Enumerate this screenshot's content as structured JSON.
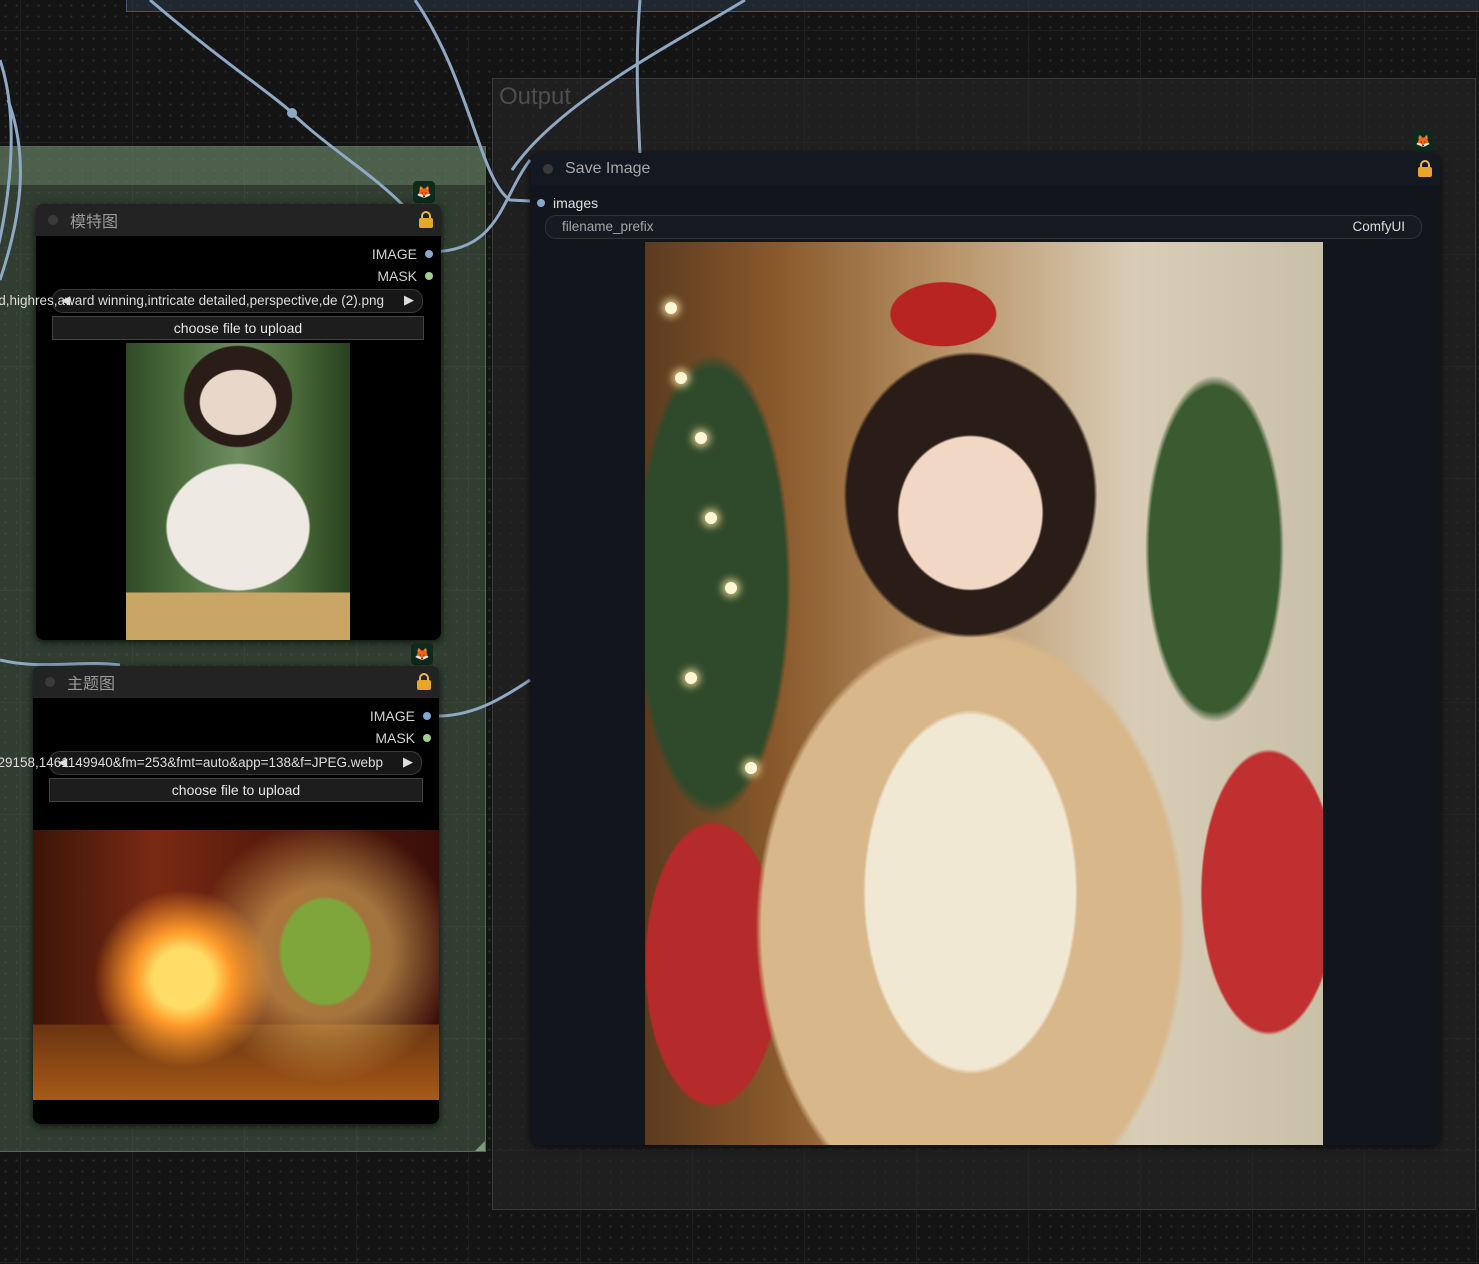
{
  "groups": {
    "output_title": "Output"
  },
  "nodes": {
    "model_image": {
      "title": "模特图",
      "outputs": {
        "image": "IMAGE",
        "mask": "MASK"
      },
      "file_value": "d,highres,award winning,intricate detailed,perspective,de (2).png",
      "upload_label": "choose file to upload",
      "preview_icon": "fox-icon"
    },
    "theme_image": {
      "title": "主题图",
      "outputs": {
        "image": "IMAGE",
        "mask": "MASK"
      },
      "file_value": "29158,1461149940&fm=253&fmt=auto&app=138&f=JPEG.webp",
      "upload_label": "choose file to upload",
      "preview_icon": "fox-icon"
    },
    "save_image": {
      "title": "Save Image",
      "input_images": "images",
      "filename_prefix_label": "filename_prefix",
      "filename_prefix_value": "ComfyUI"
    }
  },
  "colors": {
    "image_slot": "#86a8d0",
    "mask_slot": "#9fd08f",
    "lock": "#e8a52a",
    "wire": "#8fa8c4"
  }
}
